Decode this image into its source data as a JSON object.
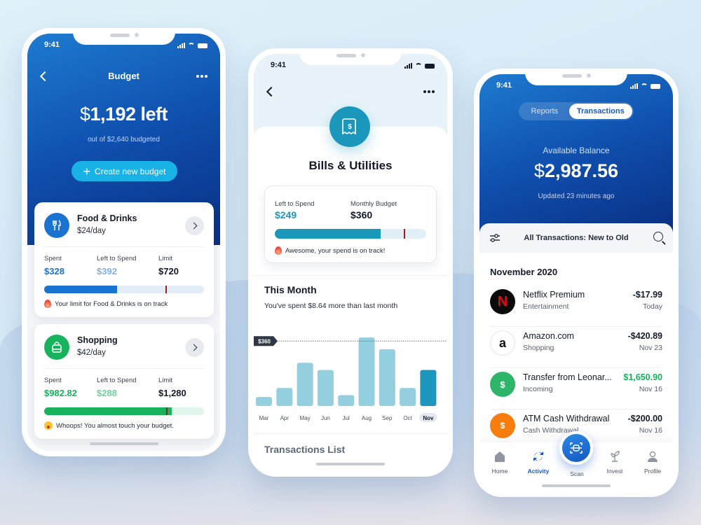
{
  "status_time": "9:41",
  "budget_screen": {
    "title": "Budget",
    "amount_currency": "$",
    "amount": "1,192 left",
    "subtitle": "out of $2,640 budgeted",
    "create_button": "Create new budget",
    "cards": [
      {
        "name": "Food & Drinks",
        "rate": "$24/day",
        "icon": "fork-knife-icon",
        "spent_label": "Spent",
        "spent": "$328",
        "left_label": "Left to Spend",
        "left": "$392",
        "limit_label": "Limit",
        "limit": "$720",
        "progress_percent": 45.5,
        "limit_marker_percent": 76,
        "note": "Your limit for Food & Drinks is on track",
        "colors": {
          "accent": "#1a73d1",
          "light": "#7fb3e8",
          "track": "#e2edf8"
        }
      },
      {
        "name": "Shopping",
        "rate": "$42/day",
        "icon": "shopping-bag-icon",
        "spent_label": "Spent",
        "spent": "$982.82",
        "left_label": "Left to Spend",
        "left": "$288",
        "limit_label": "Limit",
        "limit": "$1,280",
        "progress_percent": 80,
        "limit_marker_percent": 76.5,
        "note": "Whoops! You almost touch your budget.",
        "colors": {
          "accent": "#16b25c",
          "light": "#6fd39a",
          "track": "#e1f5ea"
        }
      }
    ]
  },
  "bills_screen": {
    "title": "Bills & Utilities",
    "left_label": "Left to Spend",
    "left_value": "$249",
    "budget_label": "Monthly Budget",
    "budget_value": "$360",
    "progress_percent": 70,
    "marker_percent": 85,
    "note": "Awesome, your spend is on track!",
    "month_title": "This Month",
    "month_subtitle": "You've spent $8.64 more than last month",
    "transactions_list_title": "Transactions List",
    "colors": {
      "accent": "#1b97bb",
      "bar_light": "#93cfdf",
      "track": "#e1f0f6"
    }
  },
  "chart_data": {
    "type": "bar",
    "categories": [
      "Mar",
      "Apr",
      "May",
      "Jun",
      "Jul",
      "Aug",
      "Sep",
      "Oct",
      "Nov"
    ],
    "values": [
      50,
      100,
      240,
      200,
      60,
      380,
      315,
      100,
      200
    ],
    "highlighted": "Nov",
    "reference_line": {
      "value": 360,
      "label": "$360"
    },
    "ylim": [
      0,
      400
    ],
    "title": "",
    "xlabel": "",
    "ylabel": "",
    "grid": false
  },
  "transactions_screen": {
    "tabs": [
      "Reports",
      "Transactions"
    ],
    "active_tab": "Transactions",
    "balance_label": "Available Balance",
    "balance_currency": "$",
    "balance": "2,987.56",
    "updated": "Updated 23 minutes ago",
    "filter_label": "All Transactions: New to Old",
    "month": "November 2020",
    "transactions": [
      {
        "name": "Netflix Premium",
        "category": "Entertainment",
        "amount": "-$17.99",
        "date": "Today",
        "icon": "netflix-logo-icon",
        "positive": false
      },
      {
        "name": "Amazon.com",
        "category": "Shopping",
        "amount": "-$420.89",
        "date": "Nov 23",
        "icon": "amazon-logo-icon",
        "positive": false
      },
      {
        "name": "Transfer from Leonar...",
        "category": "Incoming",
        "amount": "$1,650.90",
        "date": "Nov 16",
        "icon": "money-bag-icon",
        "positive": true
      },
      {
        "name": "ATM Cash Withdrawal",
        "category": "Cash Withdrawal",
        "amount": "-$200.00",
        "date": "Nov 16",
        "icon": "atm-icon",
        "positive": false
      }
    ],
    "nav": [
      {
        "label": "Home",
        "icon": "home-icon",
        "active": false
      },
      {
        "label": "Activity",
        "icon": "activity-icon",
        "active": true
      },
      {
        "label": "Scan",
        "icon": "scan-icon",
        "active": false
      },
      {
        "label": "Invest",
        "icon": "plant-icon",
        "active": false
      },
      {
        "label": "Profile",
        "icon": "profile-icon",
        "active": false
      }
    ],
    "colors": {
      "positive": "#16b25c",
      "active_nav": "#1a5ac0"
    }
  }
}
